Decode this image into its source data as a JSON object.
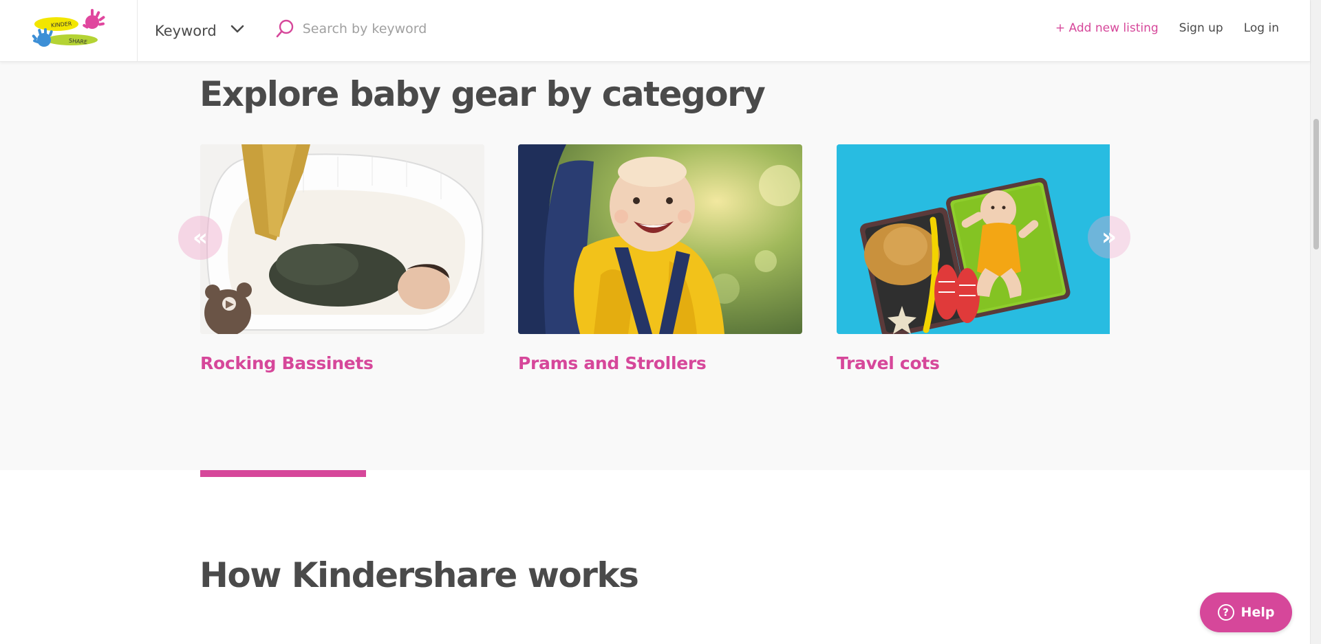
{
  "header": {
    "logo_text_top": "KINDER",
    "logo_text_bottom": "SHARE",
    "search_mode": "Keyword",
    "search_placeholder": "Search by keyword",
    "add_listing": "+ Add new listing",
    "sign_up": "Sign up",
    "log_in": "Log in"
  },
  "categories": {
    "title": "Explore baby gear by category",
    "items": [
      {
        "label": "Rocking Bassinets"
      },
      {
        "label": "Prams and Strollers"
      },
      {
        "label": "Travel cots"
      }
    ],
    "prev_label": "«",
    "next_label": "»"
  },
  "how": {
    "title": "How Kindershare works"
  },
  "help": {
    "label": "Help",
    "icon_glyph": "?"
  },
  "colors": {
    "brand_pink": "#d6479a",
    "text_dark": "#4a4a4a",
    "section_bg": "#f9f9f9"
  },
  "icons": {
    "logo": "kindershare-hands-logo",
    "dropdown": "chevron-down-icon",
    "search": "search-icon",
    "help": "question-circle-icon"
  }
}
